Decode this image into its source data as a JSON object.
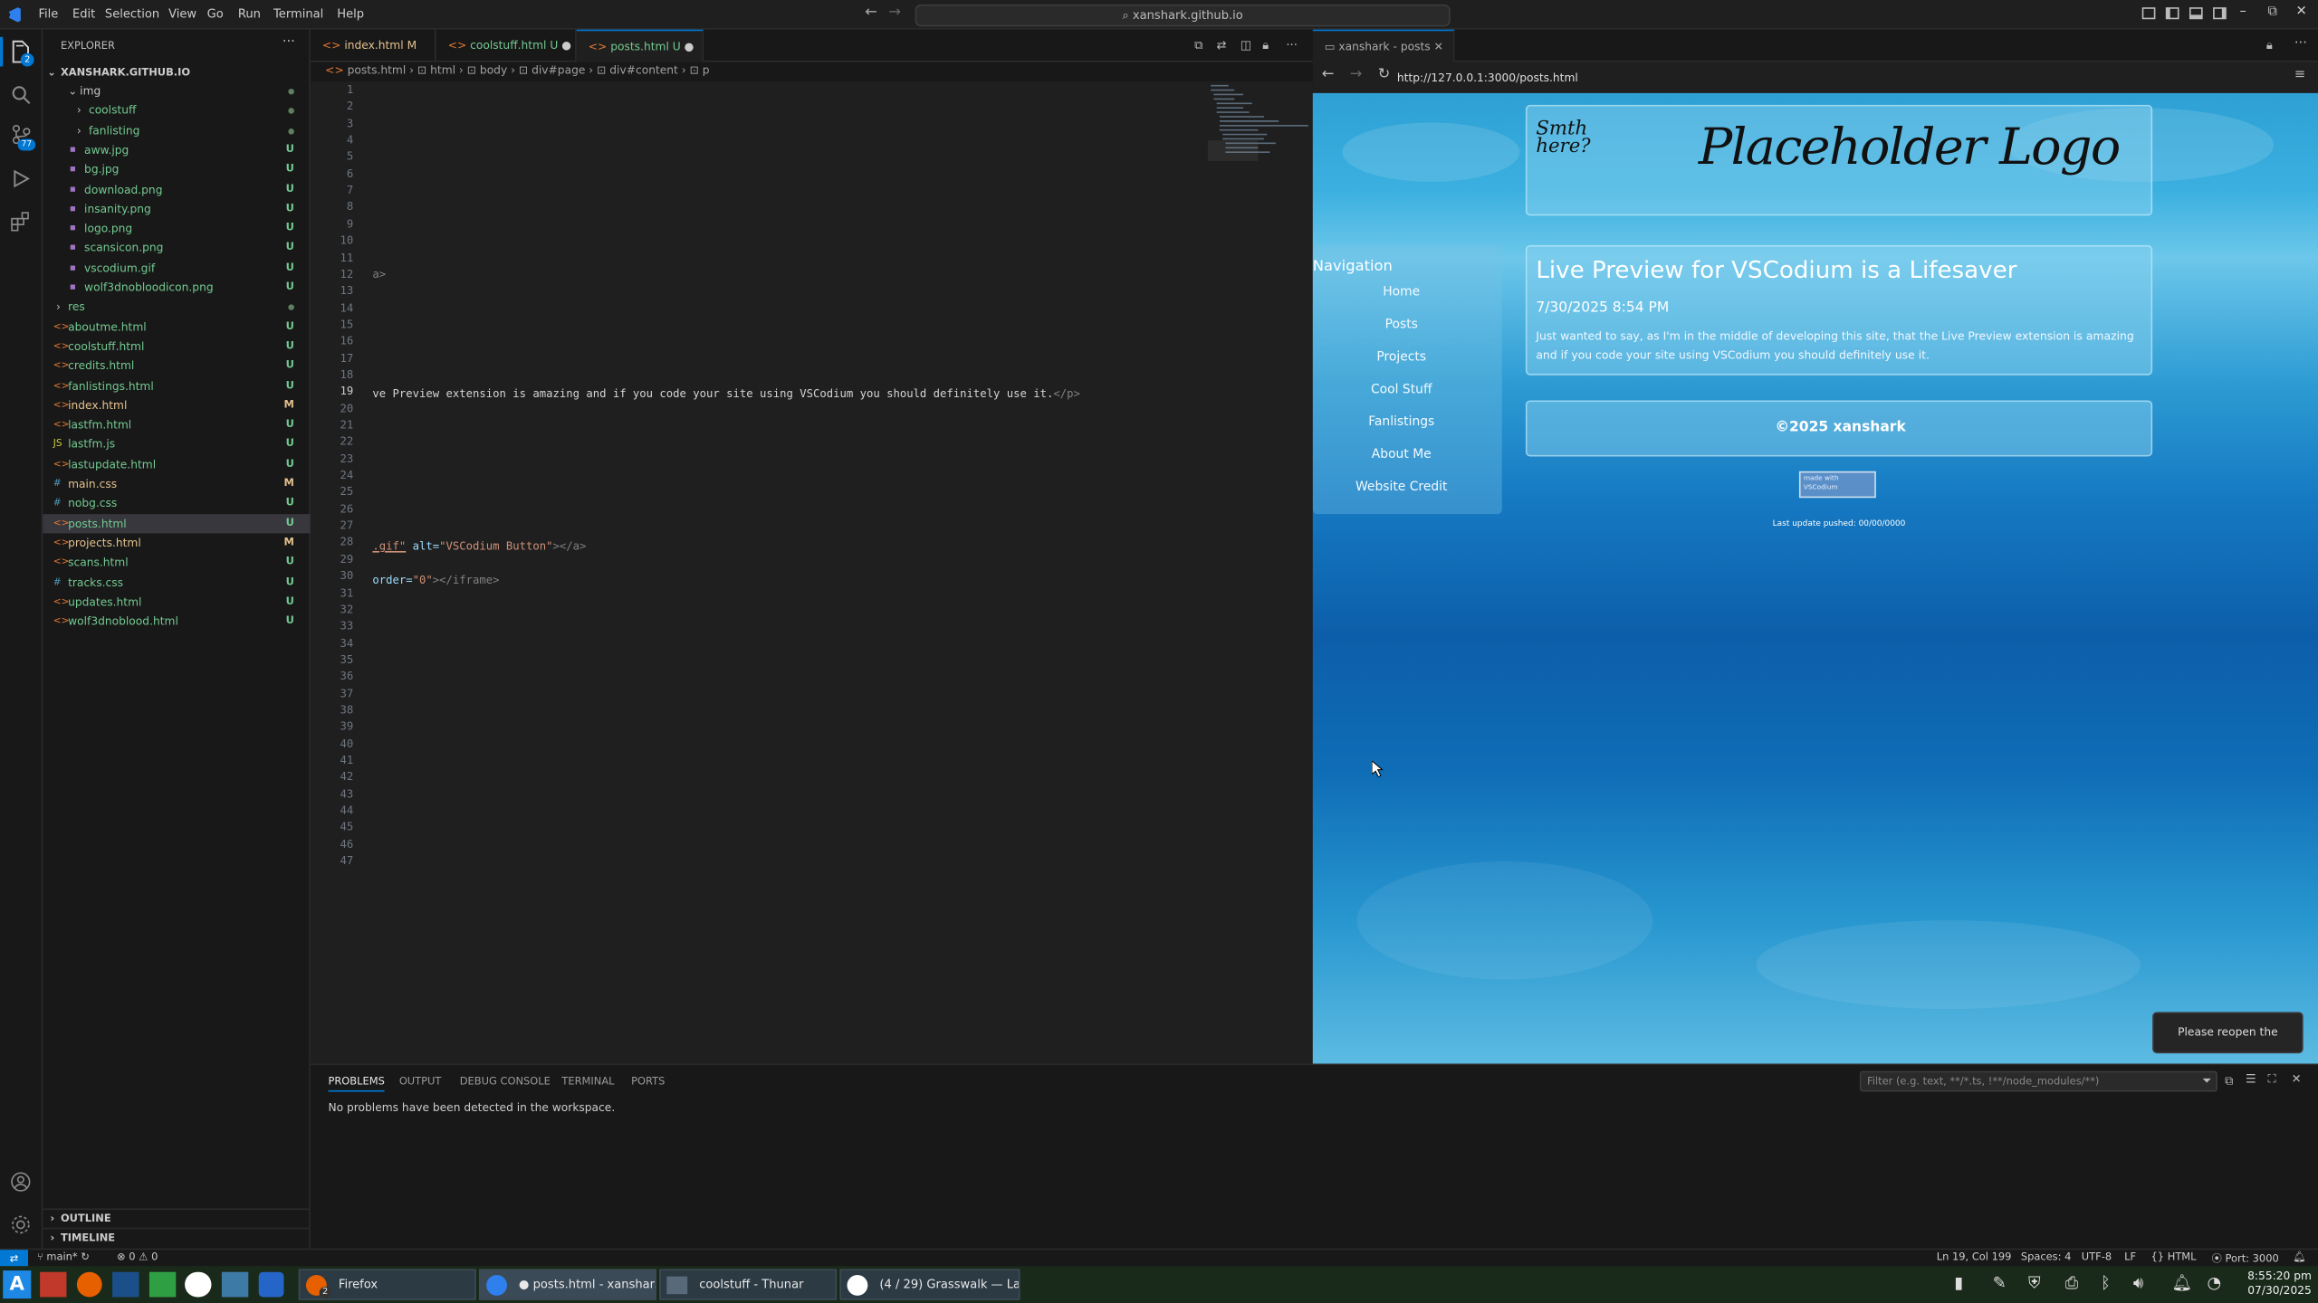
{
  "titlebar": {
    "menu": [
      "File",
      "Edit",
      "Selection",
      "View",
      "Go",
      "Run",
      "Terminal",
      "Help"
    ],
    "command_center": "xanshark.github.io"
  },
  "activity": {
    "scm_badge": "77",
    "explorer_badge": "2"
  },
  "explorer": {
    "title": "EXPLORER",
    "root": "XANSHARK.GITHUB.IO",
    "items": [
      {
        "label": "img",
        "badge": "",
        "color": "#c5c5c5"
      },
      {
        "label": "coolstuff",
        "badge": "",
        "color": "#73c991"
      },
      {
        "label": "fanlisting",
        "badge": "",
        "color": "#73c991"
      },
      {
        "label": "aww.jpg",
        "badge": "U",
        "color": "#73c991"
      },
      {
        "label": "bg.jpg",
        "badge": "U",
        "color": "#73c991"
      },
      {
        "label": "download.png",
        "badge": "U",
        "color": "#73c991"
      },
      {
        "label": "insanity.png",
        "badge": "U",
        "color": "#73c991"
      },
      {
        "label": "logo.png",
        "badge": "U",
        "color": "#73c991"
      },
      {
        "label": "scansicon.png",
        "badge": "U",
        "color": "#73c991"
      },
      {
        "label": "vscodium.gif",
        "badge": "U",
        "color": "#73c991"
      },
      {
        "label": "wolf3dnobloodicon.png",
        "badge": "U",
        "color": "#73c991"
      },
      {
        "label": "res",
        "badge": "",
        "color": "#73c991"
      },
      {
        "label": "aboutme.html",
        "badge": "U",
        "color": "#73c991"
      },
      {
        "label": "coolstuff.html",
        "badge": "U",
        "color": "#73c991"
      },
      {
        "label": "credits.html",
        "badge": "U",
        "color": "#73c991"
      },
      {
        "label": "fanlistings.html",
        "badge": "U",
        "color": "#73c991"
      },
      {
        "label": "index.html",
        "badge": "M",
        "color": "#e2c08d"
      },
      {
        "label": "lastfm.html",
        "badge": "U",
        "color": "#73c991"
      },
      {
        "label": "lastfm.js",
        "badge": "U",
        "color": "#73c991"
      },
      {
        "label": "lastupdate.html",
        "badge": "U",
        "color": "#73c991"
      },
      {
        "label": "main.css",
        "badge": "M",
        "color": "#e2c08d"
      },
      {
        "label": "nobg.css",
        "badge": "U",
        "color": "#73c991"
      },
      {
        "label": "posts.html",
        "badge": "U",
        "color": "#73c991"
      },
      {
        "label": "projects.html",
        "badge": "M",
        "color": "#e2c08d"
      },
      {
        "label": "scans.html",
        "badge": "U",
        "color": "#73c991"
      },
      {
        "label": "tracks.css",
        "badge": "U",
        "color": "#73c991"
      },
      {
        "label": "updates.html",
        "badge": "U",
        "color": "#73c991"
      },
      {
        "label": "wolf3dnoblood.html",
        "badge": "U",
        "color": "#73c991"
      }
    ],
    "outline": "OUTLINE",
    "timeline": "TIMELINE"
  },
  "tabs": [
    {
      "label": "index.html",
      "status": "M"
    },
    {
      "label": "coolstuff.html",
      "status": "U"
    },
    {
      "label": "posts.html",
      "status": "U"
    }
  ],
  "breadcrumb": [
    "posts.html",
    "html",
    "body",
    "div#page",
    "div#content",
    "p"
  ],
  "editor": {
    "line_numbers": [
      "1",
      "2",
      "3",
      "4",
      "5",
      "6",
      "7",
      "8",
      "9",
      "10",
      "11",
      "12",
      "13",
      "14",
      "15",
      "16",
      "17",
      "18",
      "19",
      "20",
      "21",
      "22",
      "23",
      "24",
      "25",
      "26",
      "27",
      "28",
      "29",
      "30",
      "31",
      "32",
      "33",
      "34",
      "35",
      "36",
      "37",
      "38",
      "39",
      "40",
      "41",
      "42",
      "43",
      "44",
      "45",
      "46",
      "47"
    ],
    "line12": "a>",
    "line19_text": "ve Preview extension is amazing and if you code your site using VSCodium you should definitely use it.",
    "line19_tag": "</p>",
    "line28_a": ".gif\"",
    "line28_b": " alt=",
    "line28_c": "\"VSCodium Button\"",
    "line28_d": "></a>",
    "line30_a": "order=",
    "line30_b": "\"0\"",
    "line30_c": "></iframe>"
  },
  "preview": {
    "tab_title": "xanshark - posts",
    "url": "http://127.0.0.1:3000/posts.html",
    "logo_small": "Smth here?",
    "logo_text": "Placeholder Logo",
    "nav_title": "Navigation",
    "nav": [
      "Home",
      "Posts",
      "Projects",
      "Cool Stuff",
      "Fanlistings",
      "About Me",
      "Website Credit"
    ],
    "post_title": "Live Preview for VSCodium is a Lifesaver",
    "post_date": "7/30/2025 8:54 PM",
    "post_body": "Just wanted to say, as I'm in the middle of developing this site, that the Live Preview extension is amazing and if you code your site using VSCodium you should definitely use it.",
    "footer": "©2025 xanshark",
    "button_text": "made with VSCodium",
    "last_update": "Last update pushed: 00/00/0000",
    "toast": "Please reopen the preview."
  },
  "panel": {
    "tabs": [
      "PROBLEMS",
      "OUTPUT",
      "DEBUG CONSOLE",
      "TERMINAL",
      "PORTS"
    ],
    "message": "No problems have been detected in the workspace.",
    "filter_placeholder": "Filter (e.g. text, **/*.ts, !**/node_modules/**)"
  },
  "statusbar": {
    "branch": "main*",
    "problems": "0",
    "warnings": "0",
    "position": "Ln 19, Col 199",
    "spaces": "Spaces: 4",
    "encoding": "UTF-8",
    "eol": "LF",
    "language": "HTML",
    "port": "Port: 3000"
  },
  "taskbar": {
    "tasks": [
      "Firefox",
      "posts.html - xanshar...",
      "coolstuff - Thunar",
      "(4 / 29) Grasswalk — La..."
    ],
    "firefox_count": "2",
    "time": "8:55:20 pm",
    "date": "07/30/2025"
  },
  "colors": {
    "accent": "#0078d4",
    "untracked": "#73c991",
    "modified": "#e2c08d",
    "tag": "#808080",
    "attr": "#9cdcfe",
    "string": "#ce9178"
  }
}
